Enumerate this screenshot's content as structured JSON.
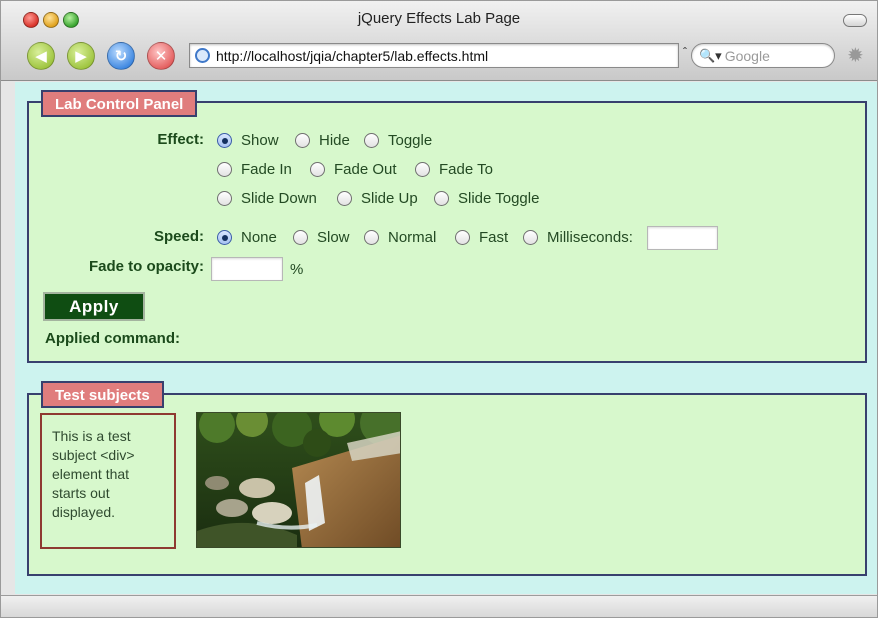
{
  "window": {
    "title": "jQuery Effects Lab Page"
  },
  "toolbar": {
    "url": "http://localhost/jqia/chapter5/lab.effects.html",
    "search_placeholder": "Google",
    "nav_icons": [
      "back-arrow-icon",
      "forward-arrow-icon",
      "reload-icon",
      "stop-icon"
    ]
  },
  "control_panel": {
    "legend": "Lab Control Panel",
    "effect_label": "Effect:",
    "effect_options": [
      "Show",
      "Hide",
      "Toggle",
      "Fade In",
      "Fade Out",
      "Fade To",
      "Slide Down",
      "Slide Up",
      "Slide Toggle"
    ],
    "effect_selected": "Show",
    "speed_label": "Speed:",
    "speed_options": [
      "None",
      "Slow",
      "Normal",
      "Fast",
      "Milliseconds:"
    ],
    "speed_selected": "None",
    "milliseconds_value": "",
    "opacity_label": "Fade to opacity:",
    "opacity_value": "",
    "opacity_unit": "%",
    "apply_label": "Apply",
    "applied_label": "Applied command:",
    "applied_value": ""
  },
  "test_subjects": {
    "legend": "Test subjects",
    "div_text": "This is a test subject <div> element that starts out displayed."
  },
  "colors": {
    "page_bg": "#cdf3ef",
    "panel_bg": "#d7f8cc",
    "legend_bg": "#e07d7d",
    "border": "#38406e",
    "apply_bg": "#0f4d12"
  }
}
